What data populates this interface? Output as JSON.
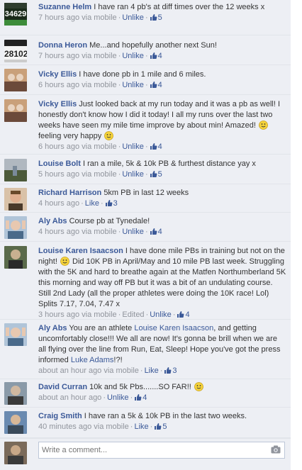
{
  "comments": [
    {
      "author": "Suzanne Helm",
      "text": "I have ran 4 pb's at diff times over the 12 weeks x",
      "time": "7 hours ago via mobile",
      "unlike": "Unlike",
      "likes": "5",
      "avatar_text": "34629",
      "avatar_colors": [
        "#1a2a1a",
        "#3d8c3a",
        "#ffffff"
      ]
    },
    {
      "author": "Donna Heron",
      "text": "Me...and hopefully another next Sun!",
      "time": "7 hours ago via mobile",
      "unlike": "Unlike",
      "likes": "4",
      "avatar_text": "28102",
      "avatar_colors": [
        "#f4f4f4",
        "#222222",
        "#222222"
      ]
    },
    {
      "author": "Vicky Ellis",
      "text": "I have done pb in 1 mile and 6 miles.",
      "time": "6 hours ago via mobile",
      "unlike": "Unlike",
      "likes": "4",
      "avatar_colors": [
        "#c9a07a",
        "#6b4a3a",
        "#e8d3c0"
      ]
    },
    {
      "author": "Vicky Ellis",
      "text_before": "Just looked back at my run today and it was a pb as well! I honestly don't know how I did it today! I all my runs over the last two weeks have seen my mile time improve by about min! Amazed!",
      "text_middle": "feeling very happy",
      "time": "6 hours ago via mobile",
      "unlike": "Unlike",
      "likes": "4",
      "avatar_colors": [
        "#c9a07a",
        "#6b4a3a",
        "#e8d3c0"
      ]
    },
    {
      "author": "Louise Bolt",
      "text": "I ran a mile, 5k & 10k PB & furthest distance yay x",
      "time": "5 hours ago via mobile",
      "unlike": "Unlike",
      "likes": "5",
      "avatar_colors": [
        "#7a8a9a",
        "#4c5a3a",
        "#b0b8c0"
      ]
    },
    {
      "author": "Richard Harrison",
      "text": "5km PB in last 12 weeks",
      "time": "4 hours ago",
      "like": "Like",
      "likes": "3",
      "avatar_colors": [
        "#c98a6a",
        "#4a3a2a",
        "#e0b090"
      ]
    },
    {
      "author": "Aly Abs",
      "text": "Course pb at Tynedale!",
      "time": "4 hours ago via mobile",
      "unlike": "Unlike",
      "likes": "4",
      "avatar_colors": [
        "#b0c4d8",
        "#4a6a8a",
        "#e8c8b0"
      ]
    },
    {
      "author": "Louise Karen Isaacson",
      "text_before": "I have done mile PBs in training but not on the night!",
      "text_after": "Did 10K PB in April/May and 10 mile PB last week. Struggling with the 5K and hard to breathe again at the Matfen Northumberland 5K this morning and way off PB but it was a bit of an undulating course. Still 2nd Lady (all the proper athletes were doing the 10K race! Lol) Splits 7.17, 7.04, 7.47 x",
      "time": "3 hours ago via mobile",
      "edited": "Edited",
      "unlike": "Unlike",
      "likes": "4",
      "avatar_colors": [
        "#5a6a4a",
        "#2a2a2a",
        "#c8b090"
      ]
    },
    {
      "author": "Aly Abs",
      "text_before": "You are an athlete",
      "mention1": "Louise Karen Isaacson",
      "text_middle": ", and getting uncomfortably close!!! We all are now! It's gonna be brill when we are all flying over the line from Run, Eat, Sleep! Hope you've got the press informed",
      "mention2": "Luke Adams",
      "text_after": "!?!",
      "time": "about an hour ago via mobile",
      "like": "Like",
      "likes": "3",
      "avatar_colors": [
        "#b0c4d8",
        "#4a6a8a",
        "#e8c8b0"
      ]
    },
    {
      "author": "David Curran",
      "text": "10k and 5k Pbs.......SO FAR!!",
      "time": "about an hour ago",
      "unlike": "Unlike",
      "likes": "4",
      "avatar_colors": [
        "#8a9aa8",
        "#3a3a3a",
        "#d0b8a0"
      ]
    },
    {
      "author": "Craig Smith",
      "text": "I have ran a 5k & 10k PB in the last two weeks.",
      "time": "40 minutes ago via mobile",
      "like": "Like",
      "likes": "5",
      "avatar_colors": [
        "#6a8ab0",
        "#3a4a5a",
        "#d8b898"
      ]
    }
  ],
  "composer": {
    "placeholder": "Write a comment...",
    "avatar_colors": [
      "#7a6a5a",
      "#3a3a3a",
      "#c8a888"
    ]
  },
  "colors": {
    "link": "#3b5998",
    "meta": "#90949c",
    "background": "#edeff4"
  }
}
